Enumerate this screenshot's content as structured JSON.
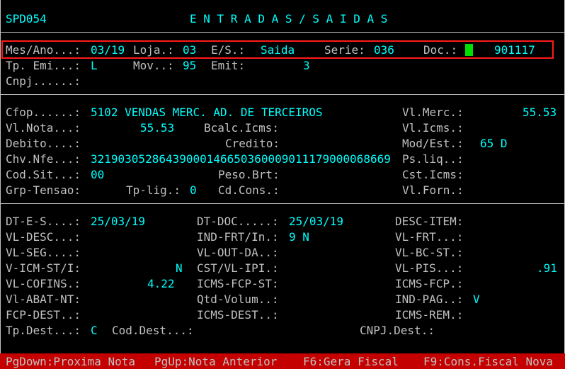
{
  "header": {
    "code": "SPD054",
    "title": "E N T R A D A S / S A I D A S"
  },
  "row1": {
    "mes_ano_label": "Mes/Ano...:",
    "mes_ano": "03/19",
    "loja_label": "Loja.:",
    "loja": "03",
    "es_label": "E/S.:",
    "es": "Saida",
    "serie_label": "Serie:",
    "serie": "036",
    "doc_label": "Doc.:",
    "doc": "901117"
  },
  "row2": {
    "tp_emi_label": "Tp. Emi...:",
    "tp_emi": "L",
    "mov_label": "Mov..:",
    "mov": "95",
    "emit_label": "Emit:",
    "emit": "3"
  },
  "row3": {
    "cnpj_label": "Cnpj......:",
    "cnpj": ""
  },
  "section2": {
    "cfop_label": "Cfop......:",
    "cfop": "5102 VENDAS MERC. AD. DE TERCEIROS",
    "vl_merc_label": "Vl.Merc.:",
    "vl_merc": "55.53",
    "vl_nota_label": "Vl.Nota...:",
    "vl_nota": "55.53",
    "bcalc_icms_label": "Bcalc.Icms:",
    "bcalc_icms": "",
    "vl_icms_label": "Vl.Icms.:",
    "vl_icms": "",
    "debito_label": "Debito....:",
    "debito": "",
    "credito_label": "Credito:",
    "credito": "",
    "mod_est_label": "Mod/Est.:",
    "mod_est": "65 D",
    "chv_nfe_label": "Chv.Nfe...:",
    "chv_nfe": "32190305286439000146650360009011179000068669",
    "ps_liq_label": "Ps.liq..:",
    "ps_liq": "",
    "cod_sit_label": "Cod.Sit...:",
    "cod_sit": "00",
    "peso_brt_label": "Peso.Brt:",
    "peso_brt": "",
    "cst_icms_label": "Cst.Icms:",
    "cst_icms": "",
    "grp_tensao_label": "Grp-Tensao:",
    "grp_tensao": "",
    "tp_lig_label": "Tp-lig.:",
    "tp_lig": "0",
    "cd_cons_label": "Cd.Cons.:",
    "cd_cons": "",
    "vl_forn_label": "Vl.Forn.:",
    "vl_forn": ""
  },
  "section3": {
    "dt_es_label": "DT-E-S....:",
    "dt_es": "25/03/19",
    "dt_doc_label": "DT-DOC.....:",
    "dt_doc": "25/03/19",
    "desc_item_label": "DESC-ITEM:",
    "desc_item": "",
    "vl_desc_label": "VL-DESC...:",
    "vl_desc": "",
    "ind_frt_label": "IND-FRT/In.:",
    "ind_frt": "9 N",
    "vl_frt_label": "VL-FRT...:",
    "vl_frt": "",
    "vl_seg_label": "VL-SEG....:",
    "vl_seg": "",
    "vl_out_da_label": "VL-OUT-DA..:",
    "vl_out_da": "",
    "vl_bc_st_label": "VL-BC-ST.:",
    "vl_bc_st": "",
    "v_icm_st_label": "V-ICM-ST/I:",
    "v_icm_st": "N",
    "cst_vl_ipi_label": "CST/VL-IPI.:",
    "cst_vl_ipi": "",
    "vl_pis_label": "VL-PIS...:",
    "vl_pis": ".91",
    "vl_cofins_label": "VL-COFINS.:",
    "vl_cofins": "4.22",
    "icms_fcp_st_label": "ICMS-FCP-ST:",
    "icms_fcp_st": "",
    "icms_fcp_label": "ICMS-FCP.:",
    "icms_fcp": "",
    "vl_abat_nt_label": "Vl-ABAT-NT:",
    "vl_abat_nt": "",
    "qtd_volum_label": "Qtd-Volum..:",
    "qtd_volum": "",
    "ind_pag_label": "IND-PAG..:",
    "ind_pag": "V",
    "fcp_dest_label": "FCP-DEST..:",
    "fcp_dest": "",
    "icms_dest_label": "ICMS-DEST..:",
    "icms_dest": "",
    "icms_rem_label": "ICMS-REM.:",
    "icms_rem": "",
    "tp_dest_label": "Tp.Dest...:",
    "tp_dest": "C",
    "cod_dest_label": "Cod.Dest...:",
    "cod_dest": "",
    "cnpj_dest_label": "CNPJ.Dest.:",
    "cnpj_dest": ""
  },
  "footer": {
    "pgdown": "PgDown:Proxima Nota",
    "pgup": "PgUp:Nota Anterior",
    "f6": "F6:Gera Fiscal",
    "f9": "F9:Cons.Fiscal Nova"
  },
  "colors": {
    "background": "#000000",
    "label": "#c0c0c0",
    "value": "#00ffff",
    "highlight": "#ff1a1a",
    "cursor": "#00e000",
    "footer": "#c40000"
  }
}
